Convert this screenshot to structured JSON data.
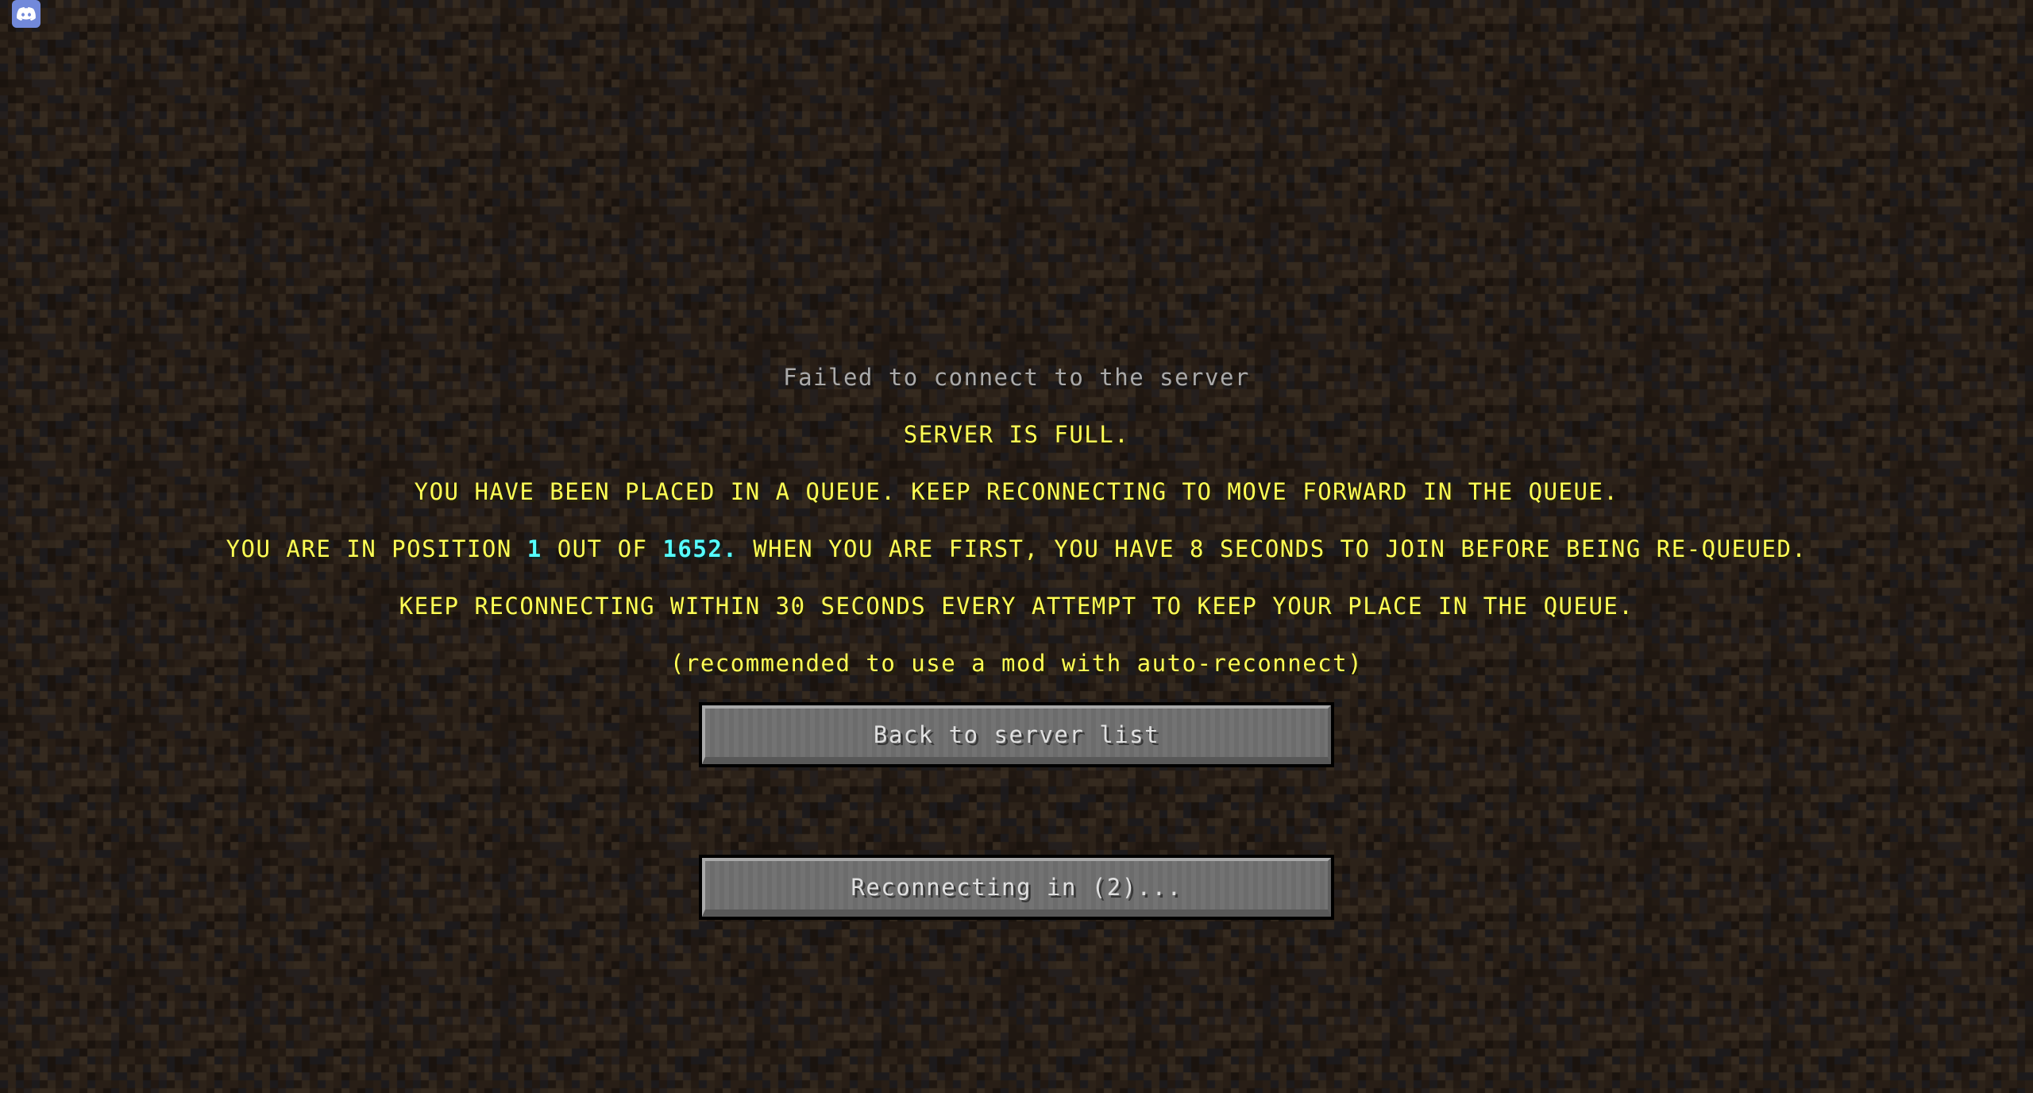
{
  "overlay": {
    "discord_icon": "discord-icon"
  },
  "disconnect_screen": {
    "title": "Failed to connect to the server",
    "lines": [
      "SERVER IS FULL.",
      "YOU HAVE BEEN PLACED IN A QUEUE. KEEP RECONNECTING TO MOVE FORWARD IN THE QUEUE."
    ],
    "position_line": {
      "prefix": "YOU ARE IN POSITION ",
      "position": "1",
      "middle": " OUT OF ",
      "total": "1652.",
      "suffix": " WHEN YOU ARE FIRST, YOU HAVE 8 SECONDS TO JOIN BEFORE BEING RE-QUEUED."
    },
    "keep_line": "KEEP RECONNECTING WITHIN 30 SECONDS EVERY ATTEMPT TO KEEP YOUR PLACE IN THE QUEUE.",
    "hint": "(recommended to use a mod with auto-reconnect)"
  },
  "buttons": {
    "back_label": "Back to server list",
    "reconnect_label": "Reconnecting in (2)..."
  },
  "colors": {
    "title": "#aaaaaa",
    "message": "#ffff55",
    "highlight": "#55ffff",
    "discord": "#7289da"
  }
}
